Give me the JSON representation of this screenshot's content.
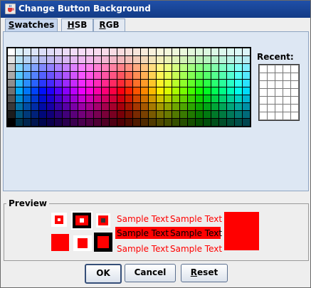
{
  "window": {
    "title": "Change Button Background"
  },
  "tabs": [
    {
      "label": "Swatches",
      "mnemonic": "S",
      "rest": "watches",
      "active": true
    },
    {
      "label": "HSB",
      "mnemonic": "H",
      "rest": "SB",
      "active": false
    },
    {
      "label": "RGB",
      "mnemonic": "R",
      "rest": "GB",
      "active": false
    }
  ],
  "swatches": {
    "columns": 31,
    "rows": 10
  },
  "recent": {
    "label": "Recent:",
    "columns": 5,
    "rows": 7
  },
  "preview": {
    "label": "Preview",
    "selected_color": "#ff0000",
    "sample_text": "Sample Text"
  },
  "buttons": {
    "ok": "OK",
    "cancel": "Cancel",
    "reset": "Reset",
    "reset_mnemonic": "R",
    "reset_rest": "eset"
  },
  "colors": {
    "title_bar": "#1f4fa8",
    "panel_background": "#dde7f3",
    "accent": "#ff0000"
  }
}
